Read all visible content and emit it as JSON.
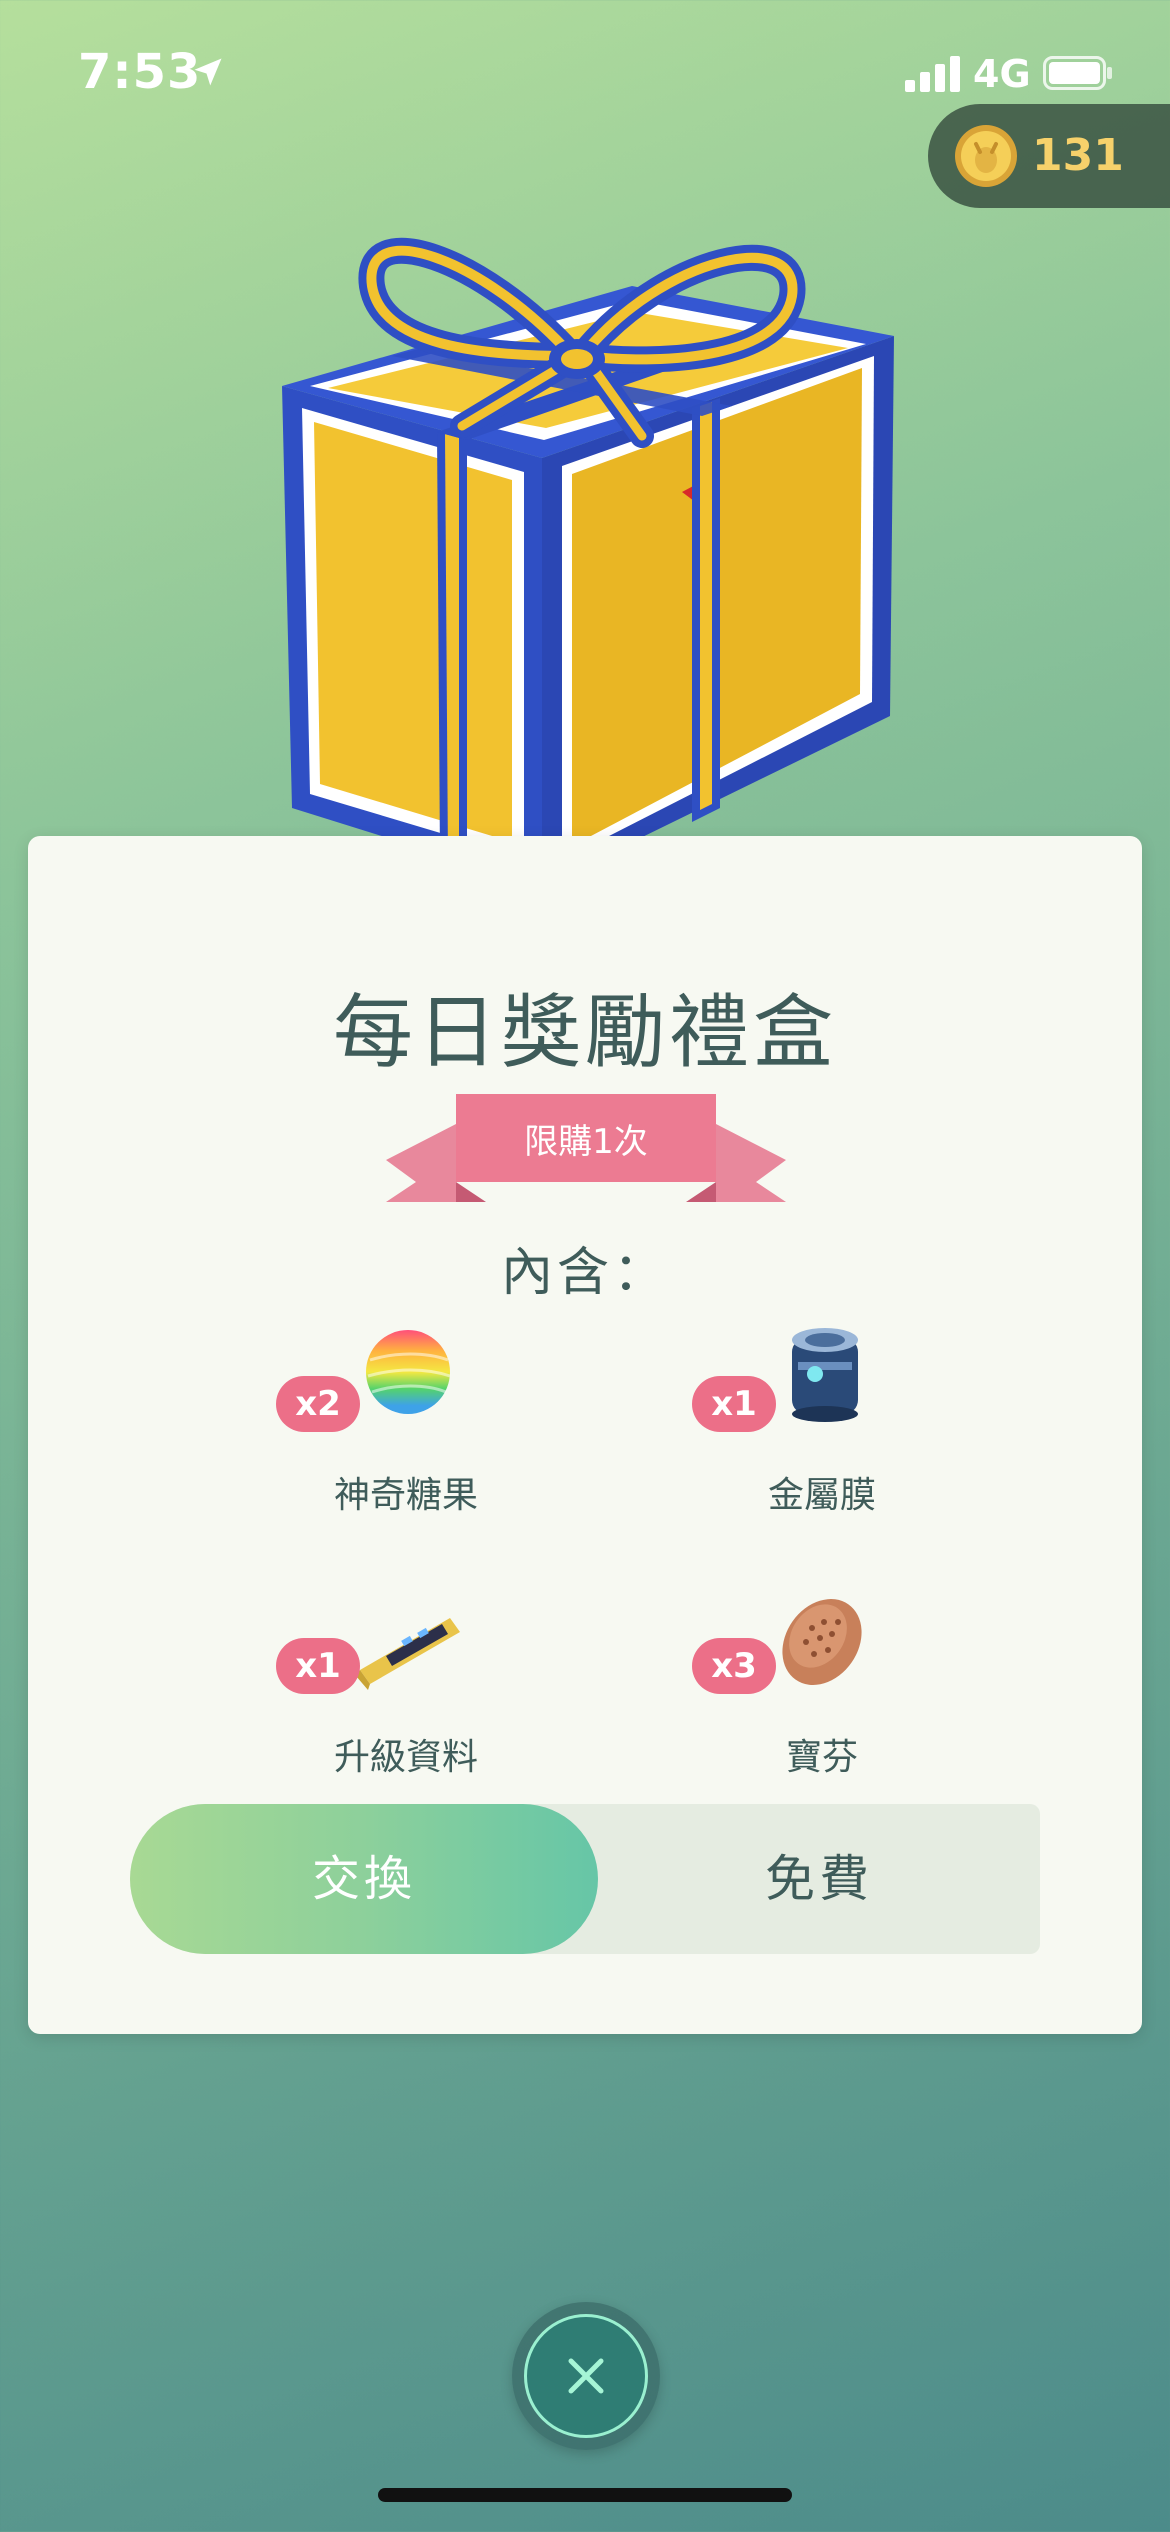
{
  "status_bar": {
    "time": "7:53",
    "network": "4G",
    "location_icon": "location-arrow-icon",
    "signal_icon": "cellular-signal-icon",
    "battery_icon": "battery-icon"
  },
  "currency": {
    "icon": "pokecoin-icon",
    "amount": "131",
    "color": "#f6d16b"
  },
  "offer": {
    "image_icon": "gift-box-icon",
    "title": "每日獎勵禮盒",
    "limit_label": "限購1次",
    "contains_label": "內含：",
    "items": [
      {
        "icon": "rare-candy-icon",
        "quantity": "x2",
        "name": "神奇糖果"
      },
      {
        "icon": "metal-coat-icon",
        "quantity": "x1",
        "name": "金屬膜"
      },
      {
        "icon": "upgrade-icon",
        "quantity": "x1",
        "name": "升級資料"
      },
      {
        "icon": "pinap-berry-icon",
        "quantity": "x3",
        "name": "寶芬"
      }
    ],
    "exchange_label": "交換",
    "price_label": "免費"
  },
  "close_button": {
    "icon": "close-icon"
  },
  "colors": {
    "accent_pink": "#ec6f88",
    "text_teal": "#3f5c5a",
    "button_green": "#8dd09b"
  }
}
